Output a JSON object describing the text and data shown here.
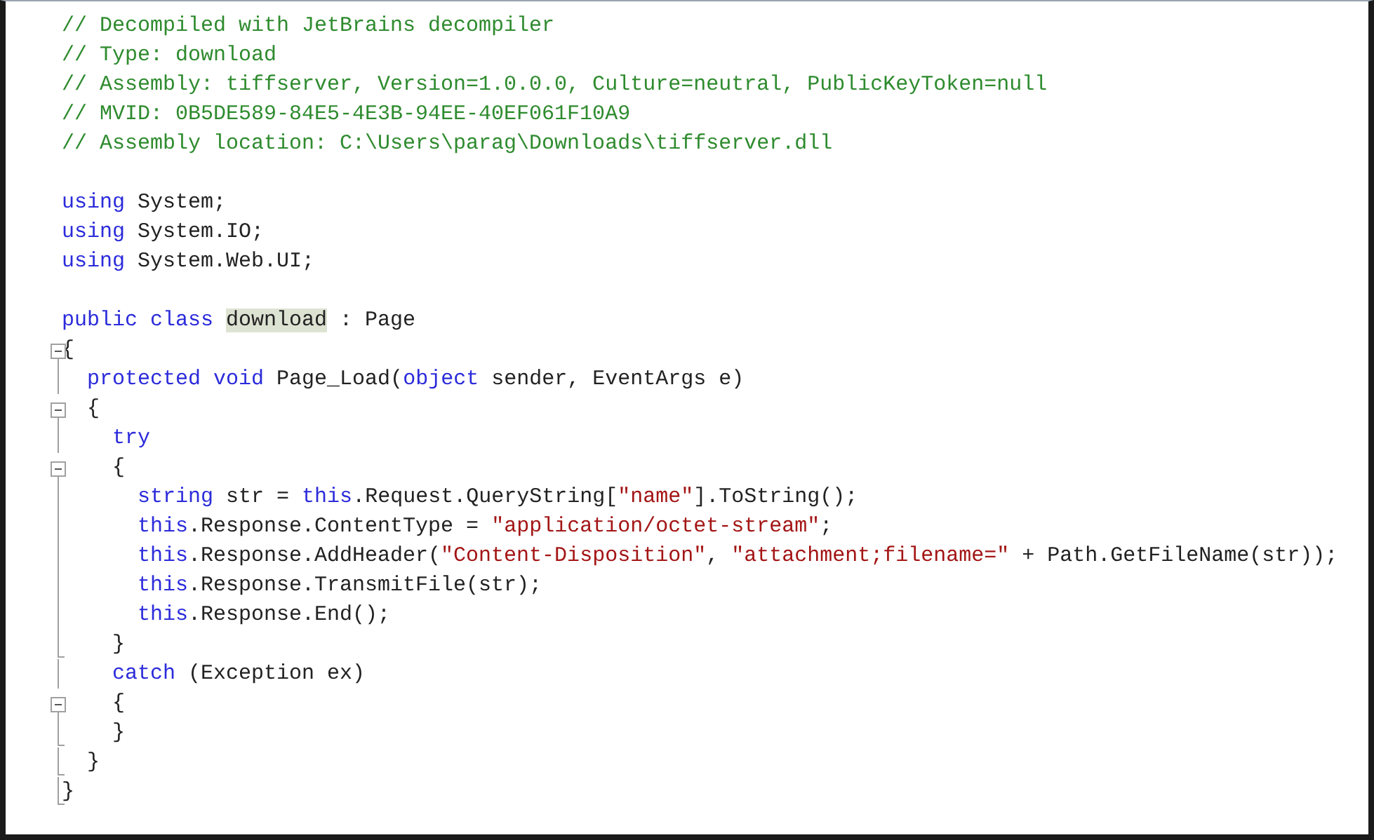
{
  "editor": {
    "lines": [
      {
        "kind": "plain",
        "tokens": [
          {
            "kind": "comment",
            "text": "// Decompiled with JetBrains decompiler"
          }
        ]
      },
      {
        "kind": "plain",
        "tokens": [
          {
            "kind": "comment",
            "text": "// Type: download"
          }
        ]
      },
      {
        "kind": "plain",
        "tokens": [
          {
            "kind": "comment",
            "text": "// Assembly: tiffserver, Version=1.0.0.0, Culture=neutral, PublicKeyToken=null"
          }
        ]
      },
      {
        "kind": "plain",
        "tokens": [
          {
            "kind": "comment",
            "text": "// MVID: 0B5DE589-84E5-4E3B-94EE-40EF061F10A9"
          }
        ]
      },
      {
        "kind": "plain",
        "tokens": [
          {
            "kind": "comment",
            "text": "// Assembly location: C:\\Users\\parag\\Downloads\\tiffserver.dll"
          }
        ]
      },
      {
        "kind": "blank"
      },
      {
        "kind": "plain",
        "tokens": [
          {
            "kind": "keyword",
            "text": "using"
          },
          {
            "kind": "plain",
            "text": " System;"
          }
        ]
      },
      {
        "kind": "plain",
        "tokens": [
          {
            "kind": "keyword",
            "text": "using"
          },
          {
            "kind": "plain",
            "text": " System.IO;"
          }
        ]
      },
      {
        "kind": "plain",
        "tokens": [
          {
            "kind": "keyword",
            "text": "using"
          },
          {
            "kind": "plain",
            "text": " System.Web.UI;"
          }
        ]
      },
      {
        "kind": "blank"
      },
      {
        "kind": "plain",
        "tokens": [
          {
            "kind": "keyword",
            "text": "public class "
          },
          {
            "kind": "highlight",
            "text": "download"
          },
          {
            "kind": "plain",
            "text": " : Page"
          }
        ]
      },
      {
        "kind": "fold",
        "tokens": [
          {
            "kind": "plain",
            "text": "{"
          }
        ]
      },
      {
        "kind": "guide",
        "tokens": [
          {
            "kind": "keyword",
            "text": "  protected void"
          },
          {
            "kind": "plain",
            "text": " Page_Load("
          },
          {
            "kind": "keyword",
            "text": "object"
          },
          {
            "kind": "plain",
            "text": " sender, EventArgs e)"
          }
        ]
      },
      {
        "kind": "fold",
        "tokens": [
          {
            "kind": "plain",
            "text": "  {"
          }
        ]
      },
      {
        "kind": "guide",
        "tokens": [
          {
            "kind": "keyword",
            "text": "    try"
          }
        ]
      },
      {
        "kind": "fold",
        "tokens": [
          {
            "kind": "plain",
            "text": "    {"
          }
        ]
      },
      {
        "kind": "guide",
        "tokens": [
          {
            "kind": "keyword",
            "text": "      string"
          },
          {
            "kind": "plain",
            "text": " str = "
          },
          {
            "kind": "keyword",
            "text": "this"
          },
          {
            "kind": "plain",
            "text": ".Request.QueryString["
          },
          {
            "kind": "string",
            "text": "\"name\""
          },
          {
            "kind": "plain",
            "text": "].ToString();"
          }
        ]
      },
      {
        "kind": "guide",
        "tokens": [
          {
            "kind": "keyword",
            "text": "      this"
          },
          {
            "kind": "plain",
            "text": ".Response.ContentType = "
          },
          {
            "kind": "string",
            "text": "\"application/octet-stream\""
          },
          {
            "kind": "plain",
            "text": ";"
          }
        ]
      },
      {
        "kind": "guide",
        "tokens": [
          {
            "kind": "keyword",
            "text": "      this"
          },
          {
            "kind": "plain",
            "text": ".Response.AddHeader("
          },
          {
            "kind": "string",
            "text": "\"Content-Disposition\""
          },
          {
            "kind": "plain",
            "text": ", "
          },
          {
            "kind": "string",
            "text": "\"attachment;filename=\""
          },
          {
            "kind": "plain",
            "text": " + Path.GetFileName(str));"
          }
        ]
      },
      {
        "kind": "guide",
        "tokens": [
          {
            "kind": "keyword",
            "text": "      this"
          },
          {
            "kind": "plain",
            "text": ".Response.TransmitFile(str);"
          }
        ]
      },
      {
        "kind": "guide",
        "tokens": [
          {
            "kind": "keyword",
            "text": "      this"
          },
          {
            "kind": "plain",
            "text": ".Response.End();"
          }
        ]
      },
      {
        "kind": "end",
        "tokens": [
          {
            "kind": "plain",
            "text": "    }"
          }
        ]
      },
      {
        "kind": "guide",
        "tokens": [
          {
            "kind": "keyword",
            "text": "    catch"
          },
          {
            "kind": "plain",
            "text": " (Exception ex)"
          }
        ]
      },
      {
        "kind": "fold",
        "tokens": [
          {
            "kind": "plain",
            "text": "    {"
          }
        ]
      },
      {
        "kind": "end",
        "tokens": [
          {
            "kind": "plain",
            "text": "    }"
          }
        ]
      },
      {
        "kind": "end",
        "tokens": [
          {
            "kind": "plain",
            "text": "  }"
          }
        ]
      },
      {
        "kind": "end",
        "tokens": [
          {
            "kind": "plain",
            "text": "}"
          }
        ]
      }
    ]
  }
}
